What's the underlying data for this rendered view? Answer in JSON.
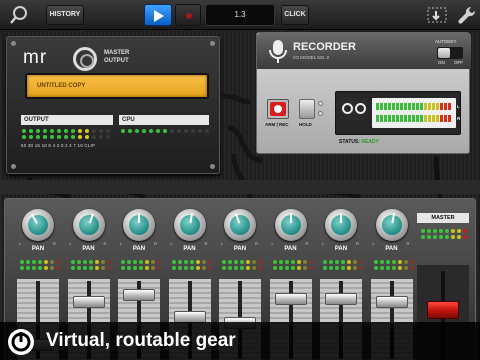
{
  "toolbar": {
    "search_icon": "magnifier-icon",
    "history_label": "HISTORY",
    "counter_value": "1.3",
    "click_label": "CLICK",
    "route_icon": "routing-icon",
    "settings_icon": "wrench-icon",
    "accent": "#1e7fe6"
  },
  "mro": {
    "logo": "mr",
    "subtitle_1": "MASTER",
    "subtitle_2": "OUTPUT",
    "lcd_text": "UNTITLED COPY",
    "output_label": "OUTPUT",
    "cpu_label": "CPU",
    "scale": "50 30 15 10 6 4 2 0 2 4 7 10 CLIP"
  },
  "recorder": {
    "title": "RECORDER",
    "model": "I/O MODEL NO. 2",
    "autokey_label": "AUTOKEY",
    "on_label": "ON",
    "off_label": "OFF",
    "arm_label": "ARM | REC",
    "hold_label": "HOLD",
    "l_label": "L",
    "r_label": "R",
    "status_label": "STATUS:",
    "status_value": "READY"
  },
  "mixer": {
    "channels": [
      {
        "pan_label": "PAN",
        "pan_angle": -30,
        "fader_level": 0.12
      },
      {
        "pan_label": "PAN",
        "pan_angle": 20,
        "fader_level": 0.78
      },
      {
        "pan_label": "PAN",
        "pan_angle": 0,
        "fader_level": 0.88
      },
      {
        "pan_label": "PAN",
        "pan_angle": 10,
        "fader_level": 0.55
      },
      {
        "pan_label": "PAN",
        "pan_angle": -20,
        "fader_level": 0.45
      },
      {
        "pan_label": "PAN",
        "pan_angle": 0,
        "fader_level": 0.82
      },
      {
        "pan_label": "PAN",
        "pan_angle": 0,
        "fader_level": 0.82
      },
      {
        "pan_label": "PAN",
        "pan_angle": 10,
        "fader_level": 0.78
      }
    ],
    "master_label": "MASTER",
    "knob_color": "#1f8d86"
  },
  "caption": {
    "text": "Virtual, routable gear"
  }
}
